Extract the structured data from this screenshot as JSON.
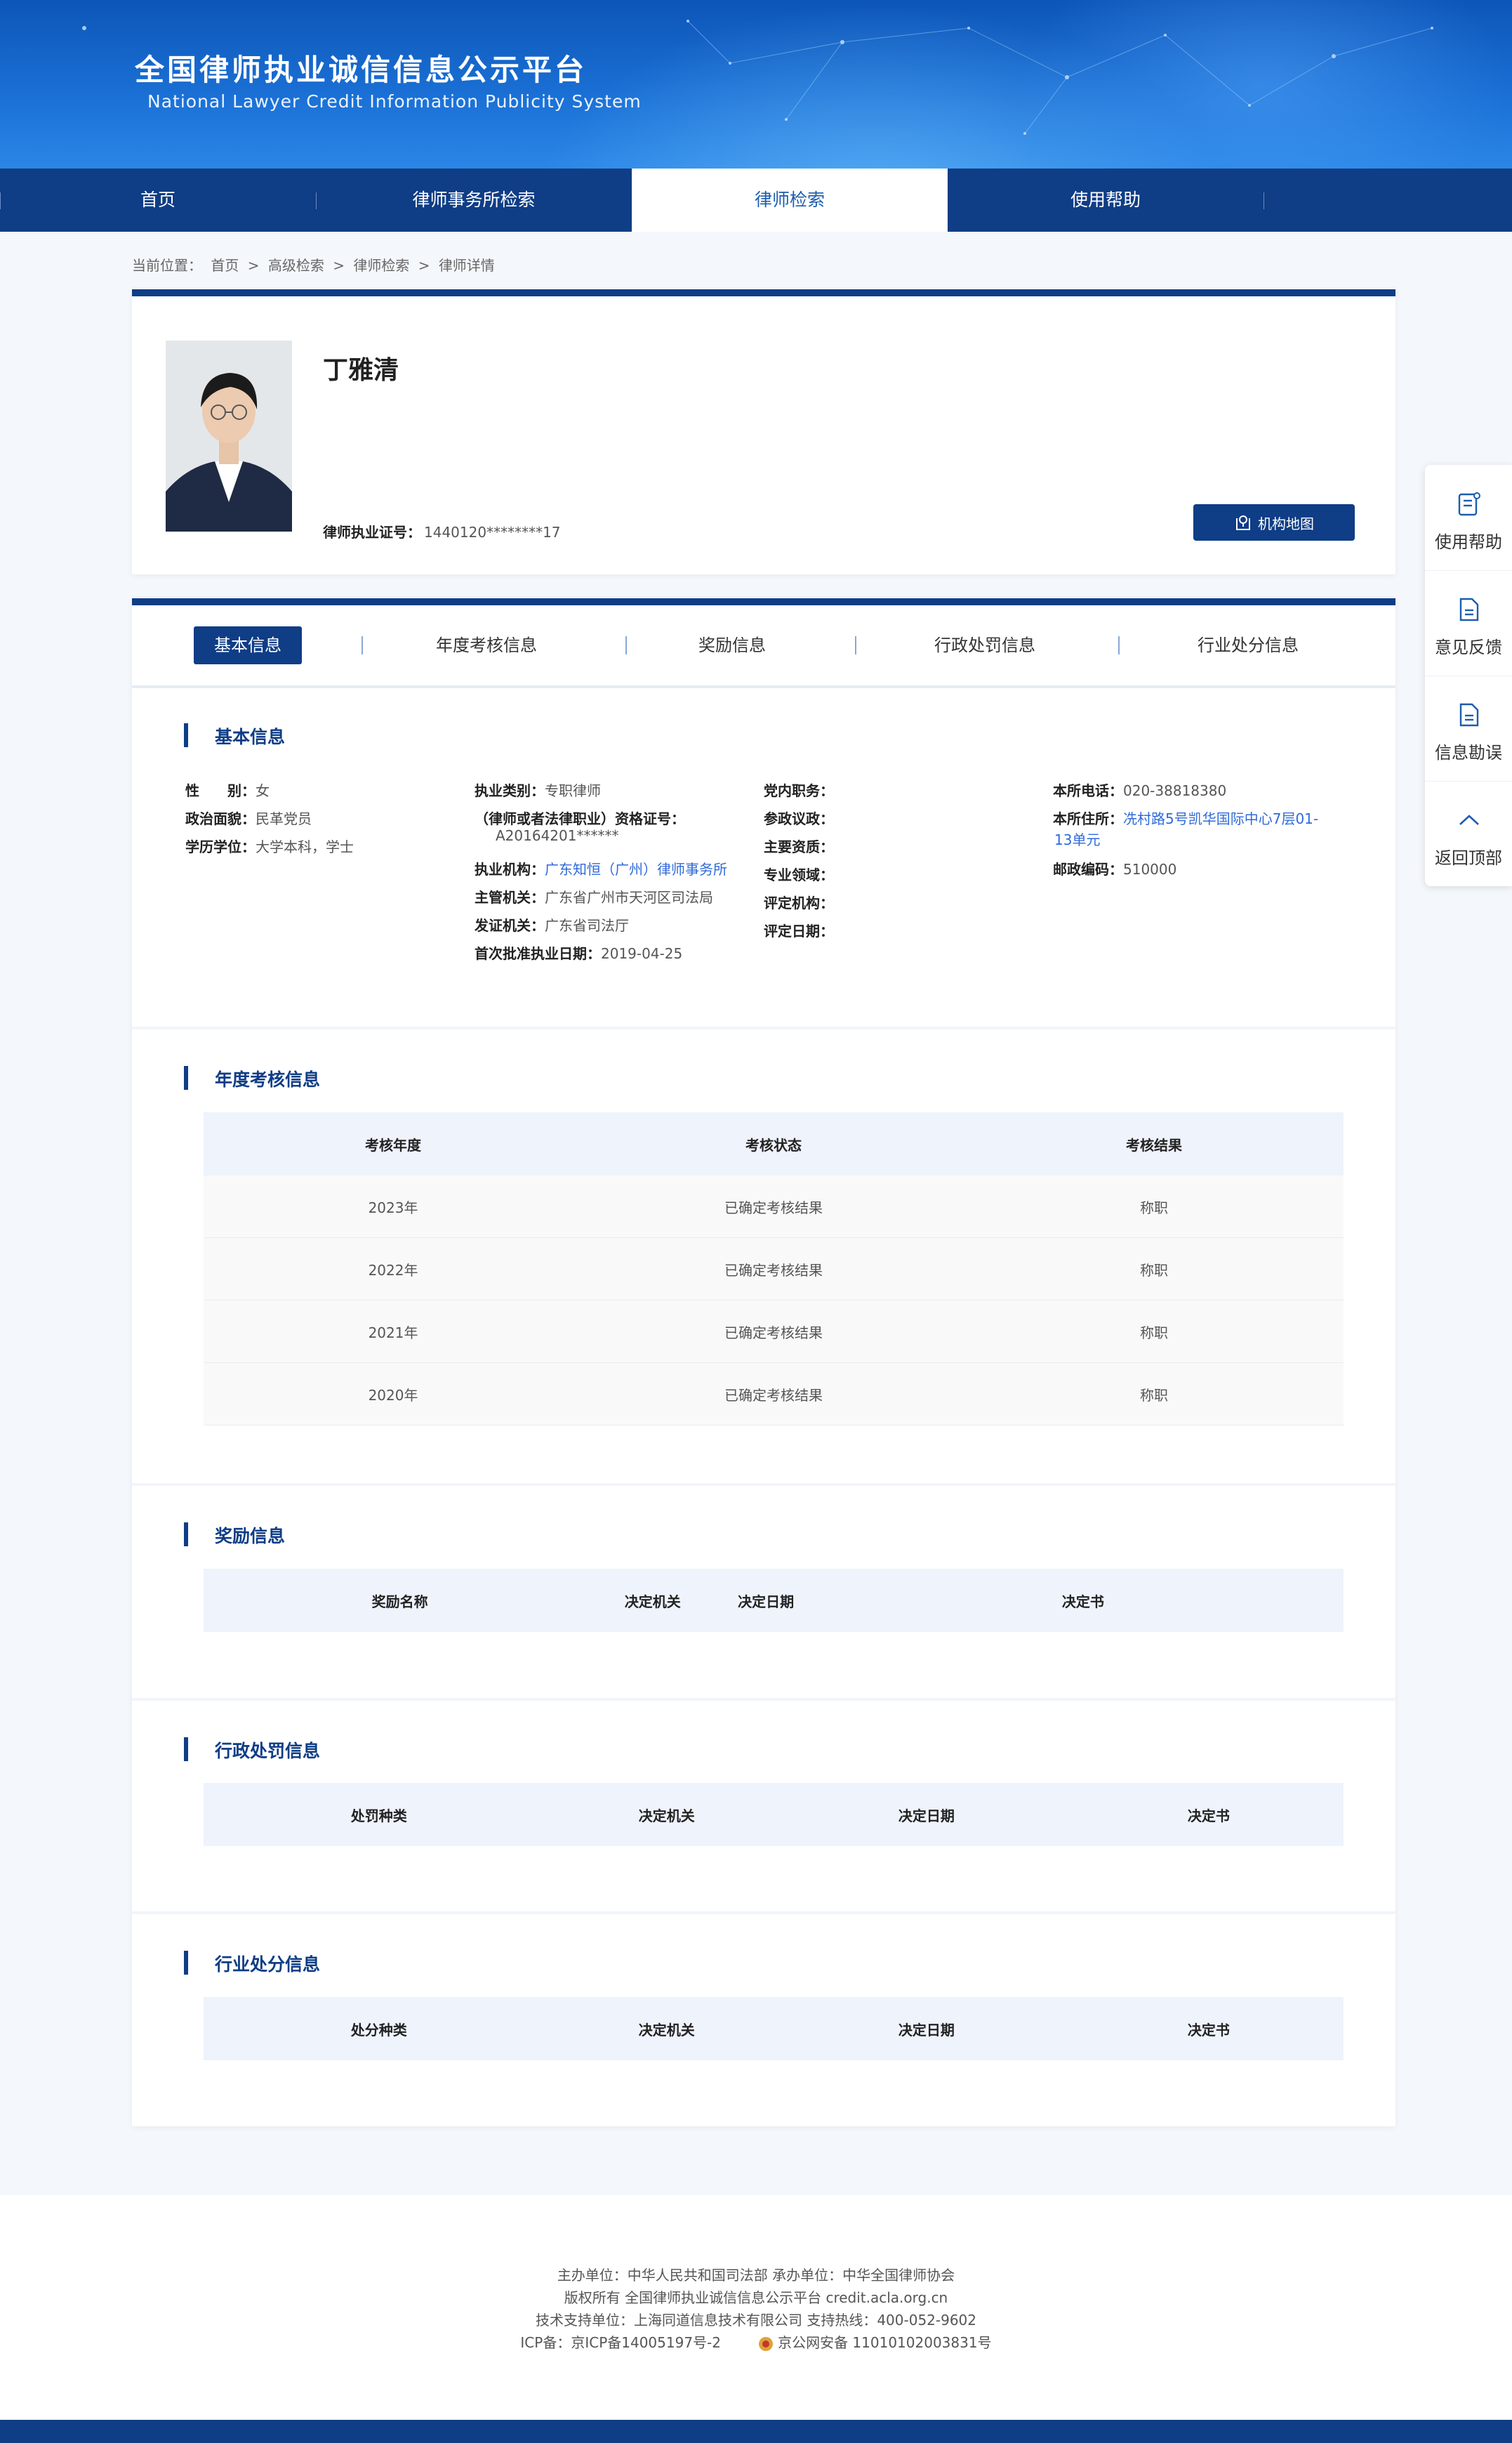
{
  "header": {
    "title": "全国律师执业诚信信息公示平台",
    "subtitle": "National Lawyer Credit Information Publicity System"
  },
  "nav": {
    "items": [
      {
        "label": "首页"
      },
      {
        "label": "律师事务所检索"
      },
      {
        "label": "律师检索",
        "active": true
      },
      {
        "label": "使用帮助"
      }
    ]
  },
  "breadcrumb": {
    "prefix": "当前位置：",
    "items": [
      "首页",
      ">",
      "高级检索",
      ">",
      "律师检索",
      ">",
      "律师详情"
    ]
  },
  "profile": {
    "name": "丁雅清",
    "license_label": "律师执业证号：",
    "license_value": "1440120********17",
    "map_button": "机构地图"
  },
  "tabs": [
    {
      "label": "基本信息",
      "active": true
    },
    {
      "label": "年度考核信息"
    },
    {
      "label": "奖励信息"
    },
    {
      "label": "行政处罚信息"
    },
    {
      "label": "行业处分信息"
    }
  ],
  "basic": {
    "title": "基本信息",
    "col1": [
      {
        "k": "性　　别：",
        "v": "女"
      },
      {
        "k": "政治面貌：",
        "v": "民革党员"
      },
      {
        "k": "学历学位：",
        "v": "大学本科，学士"
      }
    ],
    "col2": {
      "practice_type_k": "执业类别：",
      "practice_type_v": "专职律师",
      "qual_k": "（律师或者法律职业）资格证号：",
      "qual_v": "A20164201******",
      "org_k": "执业机构：",
      "org_v": "广东知恒（广州）律师事务所",
      "authority_k": "主管机关：",
      "authority_v": "广东省广州市天河区司法局",
      "issuer_k": "发证机关：",
      "issuer_v": "广东省司法厅",
      "first_date_k": "首次批准执业日期：",
      "first_date_v": "2019-04-25"
    },
    "col3": [
      {
        "k": "党内职务：",
        "v": ""
      },
      {
        "k": "参政议政：",
        "v": ""
      },
      {
        "k": "主要资质：",
        "v": ""
      },
      {
        "k": "专业领域：",
        "v": ""
      },
      {
        "k": "评定机构：",
        "v": ""
      },
      {
        "k": "评定日期：",
        "v": ""
      }
    ],
    "col4": {
      "phone_k": "本所电话：",
      "phone_v": "020-38818380",
      "address_k": "本所住所：",
      "address_v1": "冼村路5号凯华国际中心7层01-",
      "address_v2": "13单元",
      "zip_k": "邮政编码：",
      "zip_v": "510000"
    }
  },
  "annual": {
    "title": "年度考核信息",
    "headers": [
      "考核年度",
      "考核状态",
      "考核结果"
    ],
    "rows": [
      [
        "2023年",
        "已确定考核结果",
        "称职"
      ],
      [
        "2022年",
        "已确定考核结果",
        "称职"
      ],
      [
        "2021年",
        "已确定考核结果",
        "称职"
      ],
      [
        "2020年",
        "已确定考核结果",
        "称职"
      ]
    ]
  },
  "rewards": {
    "title": "奖励信息",
    "headers": [
      "奖励名称",
      "决定机关",
      "决定日期",
      "决定书"
    ]
  },
  "admin_penalty": {
    "title": "行政处罚信息",
    "headers": [
      "处罚种类",
      "决定机关",
      "决定日期",
      "决定书"
    ]
  },
  "industry_penalty": {
    "title": "行业处分信息",
    "headers": [
      "处分种类",
      "决定机关",
      "决定日期",
      "决定书"
    ]
  },
  "side": {
    "items": [
      {
        "label": "使用帮助",
        "icon": "help-doc-icon"
      },
      {
        "label": "意见反馈",
        "icon": "feedback-doc-icon"
      },
      {
        "label": "信息勘误",
        "icon": "correction-doc-icon"
      },
      {
        "label": "返回顶部",
        "icon": "chevron-up-icon"
      }
    ]
  },
  "footer": {
    "line1": "主办单位：中华人民共和国司法部 承办单位：中华全国律师协会",
    "line2": "版权所有 全国律师执业诚信信息公示平台 credit.acla.org.cn",
    "line3": "技术支持单位：上海同道信息技术有限公司 支持热线：400-052-9602",
    "icp": "ICP备：京ICP备14005197号-2",
    "police": "京公网安备 11010102003831号"
  },
  "colors": {
    "primary": "#0f3d86",
    "link": "#2f6ad9",
    "table_header_bg": "#eef3fc"
  }
}
